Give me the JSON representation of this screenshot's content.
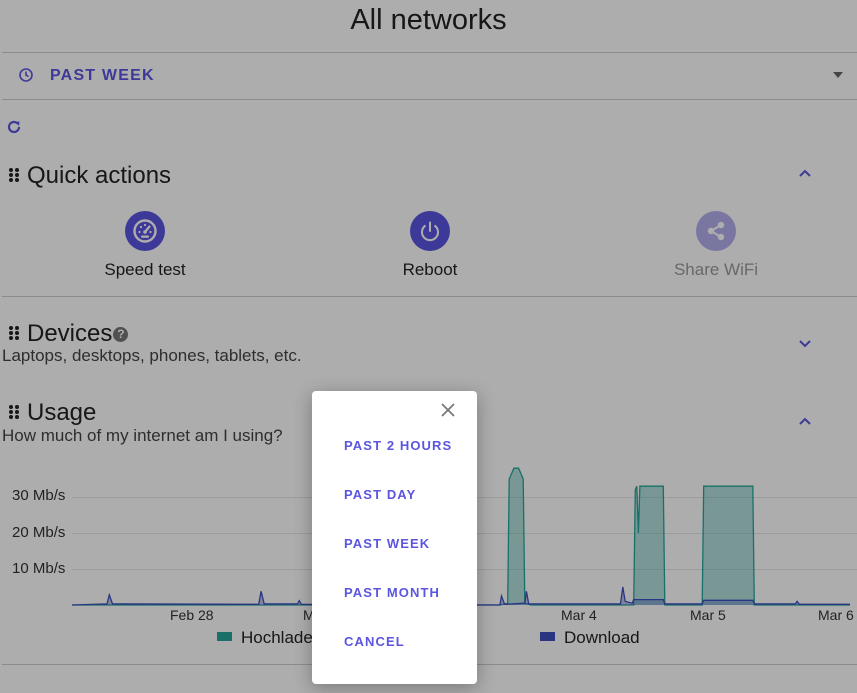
{
  "header": {
    "title": "All networks"
  },
  "period_selector": {
    "label": "PAST WEEK",
    "clock_icon": "clock-icon",
    "caret_icon": "caret-down-icon"
  },
  "refresh": {
    "icon": "refresh-icon"
  },
  "quick_actions": {
    "title": "Quick actions",
    "expanded": true,
    "actions": [
      {
        "label": "Speed test",
        "icon": "speedometer-icon",
        "enabled": true
      },
      {
        "label": "Reboot",
        "icon": "power-icon",
        "enabled": true
      },
      {
        "label": "Share WiFi",
        "icon": "share-icon",
        "enabled": false
      }
    ]
  },
  "devices": {
    "title": "Devices",
    "help_glyph": "?",
    "subtitle": "Laptops, desktops, phones, tablets, etc.",
    "expanded": false
  },
  "usage": {
    "title": "Usage",
    "subtitle": "How much of my internet am I using?",
    "expanded": true,
    "legend": [
      {
        "label": "Hochlade",
        "color": "#26a69a"
      },
      {
        "label": "Download",
        "color": "#3f4fbf"
      }
    ]
  },
  "chart_data": {
    "type": "area",
    "y_unit": "Mb/s",
    "y_ticks": [
      "10 Mb/s",
      "20 Mb/s",
      "30 Mb/s"
    ],
    "x_ticks": [
      "Feb 28",
      "M",
      "Mar 4",
      "Mar 5",
      "Mar 6"
    ],
    "ylim": [
      0,
      38
    ],
    "grid": true,
    "series": [
      {
        "name": "Hochlade",
        "color": "#26a69a",
        "points": [
          [
            0,
            0
          ],
          [
            0.55,
            0
          ],
          [
            0.56,
            0.5
          ],
          [
            0.562,
            35
          ],
          [
            0.568,
            38
          ],
          [
            0.574,
            38
          ],
          [
            0.58,
            35
          ],
          [
            0.582,
            0.5
          ],
          [
            0.59,
            0
          ],
          [
            0.722,
            0
          ],
          [
            0.724,
            32
          ],
          [
            0.726,
            33
          ],
          [
            0.728,
            20
          ],
          [
            0.73,
            33
          ],
          [
            0.76,
            33
          ],
          [
            0.762,
            0
          ],
          [
            0.81,
            0
          ],
          [
            0.812,
            33
          ],
          [
            0.818,
            33
          ],
          [
            0.875,
            33
          ],
          [
            0.877,
            0
          ],
          [
            1,
            0
          ]
        ]
      },
      {
        "name": "Download",
        "color": "#3f4fbf",
        "points": [
          [
            0,
            0
          ],
          [
            0.045,
            0.3
          ],
          [
            0.048,
            2.8
          ],
          [
            0.052,
            0.3
          ],
          [
            0.24,
            0.2
          ],
          [
            0.243,
            3.8
          ],
          [
            0.247,
            0.3
          ],
          [
            0.29,
            0.3
          ],
          [
            0.292,
            1.2
          ],
          [
            0.295,
            0.2
          ],
          [
            0.55,
            0
          ],
          [
            0.552,
            2.5
          ],
          [
            0.556,
            0.2
          ],
          [
            0.582,
            0.5
          ],
          [
            0.584,
            3.8
          ],
          [
            0.587,
            0.3
          ],
          [
            0.705,
            0.3
          ],
          [
            0.708,
            5
          ],
          [
            0.711,
            1
          ],
          [
            0.72,
            0.5
          ],
          [
            0.722,
            1.5
          ],
          [
            0.76,
            1.5
          ],
          [
            0.762,
            0.3
          ],
          [
            0.81,
            0.3
          ],
          [
            0.812,
            1.3
          ],
          [
            0.875,
            1.3
          ],
          [
            0.877,
            0.3
          ],
          [
            0.93,
            0.3
          ],
          [
            0.932,
            1
          ],
          [
            0.935,
            0.2
          ],
          [
            1,
            0.2
          ]
        ]
      }
    ]
  },
  "dialog": {
    "close_icon": "close-icon",
    "options": [
      "PAST 2 HOURS",
      "PAST DAY",
      "PAST WEEK",
      "PAST MONTH",
      "CANCEL"
    ]
  }
}
